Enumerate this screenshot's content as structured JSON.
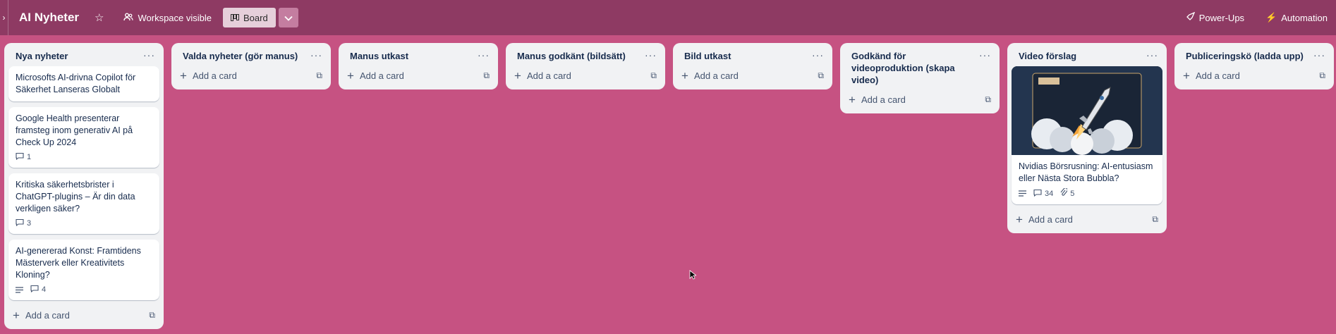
{
  "header": {
    "board_title": "AI Nyheter",
    "visibility_label": "Workspace visible",
    "view_label": "Board",
    "powerups_label": "Power-Ups",
    "automation_label": "Automation"
  },
  "add_card_label": "Add a card",
  "lists": [
    {
      "title": "Nya nyheter",
      "cards": [
        {
          "title": "Microsofts AI-drivna Copilot för Säkerhet Lanseras Globalt"
        },
        {
          "title": "Google Health presenterar framsteg inom generativ AI på Check Up 2024",
          "comments": "1"
        },
        {
          "title": "Kritiska säkerhetsbrister i ChatGPT-plugins – Är din data verkligen säker?",
          "comments": "3"
        },
        {
          "title": "AI-genererad Konst: Framtidens Mästerverk eller Kreativitets Kloning?",
          "comments": "4"
        }
      ]
    },
    {
      "title": "Valda nyheter (gör manus)",
      "cards": []
    },
    {
      "title": "Manus utkast",
      "cards": []
    },
    {
      "title": "Manus godkänt (bildsätt)",
      "cards": []
    },
    {
      "title": "Bild utkast",
      "cards": []
    },
    {
      "title": "Godkänd för videoproduktion (skapa video)",
      "cards": []
    },
    {
      "title": "Video förslag",
      "cards": [
        {
          "title": "Nvidias Börsrusning: AI-entusiasm eller Nästa Stora Bubbla?",
          "comments": "34",
          "attachments": "5",
          "cover": "rocket-illustration"
        }
      ]
    },
    {
      "title": "Publiceringskö (ladda upp)",
      "cards": []
    }
  ],
  "colors": {
    "board_background": "#c65282",
    "header_background": "#8e3a63",
    "list_background": "#f1f2f4"
  }
}
